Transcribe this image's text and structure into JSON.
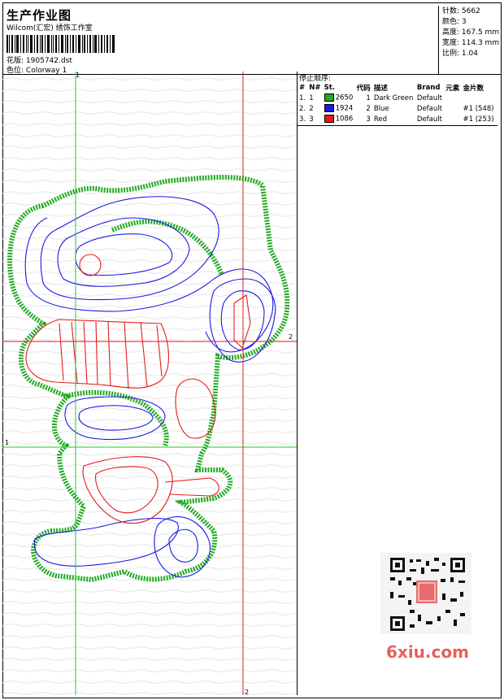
{
  "header": {
    "title": "生产作业图",
    "company": "Wilcom(汇宏) 绣饰工作室",
    "design_label": "花版:",
    "design_value": "1905742.dst",
    "colorway_label": "色位:",
    "colorway_value": "Colorway 1"
  },
  "stats": {
    "stitches_label": "针数:",
    "stitches_value": "5662",
    "colors_label": "颜色:",
    "colors_value": "3",
    "height_label": "高度:",
    "height_value": "167.5 mm",
    "width_label": "宽度:",
    "width_value": "114.3 mm",
    "scale_label": "比例:",
    "scale_value": "1.04"
  },
  "stop_sequence": {
    "caption": "停止顺序:",
    "columns": [
      "#",
      "N#",
      "St.",
      "代码",
      "描述",
      "Brand",
      "元素",
      "金片数"
    ],
    "rows": [
      {
        "idx": "1.",
        "n": "1",
        "swatch": "#22aa22",
        "st": "2650",
        "code": "1",
        "desc": "Dark Green",
        "brand": "Default",
        "elem": "",
        "seq": ""
      },
      {
        "idx": "2.",
        "n": "2",
        "swatch": "#1a1ae6",
        "st": "1924",
        "code": "2",
        "desc": "Blue",
        "brand": "Default",
        "elem": "",
        "seq": "#1 (548)"
      },
      {
        "idx": "3.",
        "n": "3",
        "swatch": "#e61a1a",
        "st": "1086",
        "code": "3",
        "desc": "Red",
        "brand": "Default",
        "elem": "",
        "seq": "#1 (253)"
      }
    ]
  },
  "guides": {
    "v1": "1",
    "h1": "1",
    "v2": "2",
    "h2": "2"
  },
  "watermark": "6xiu.com",
  "colors": {
    "green": "#22aa22",
    "blue": "#1a1ae6",
    "red": "#e61a1a",
    "guide_green": "#22cc22",
    "guide_red": "#e61a1a"
  }
}
